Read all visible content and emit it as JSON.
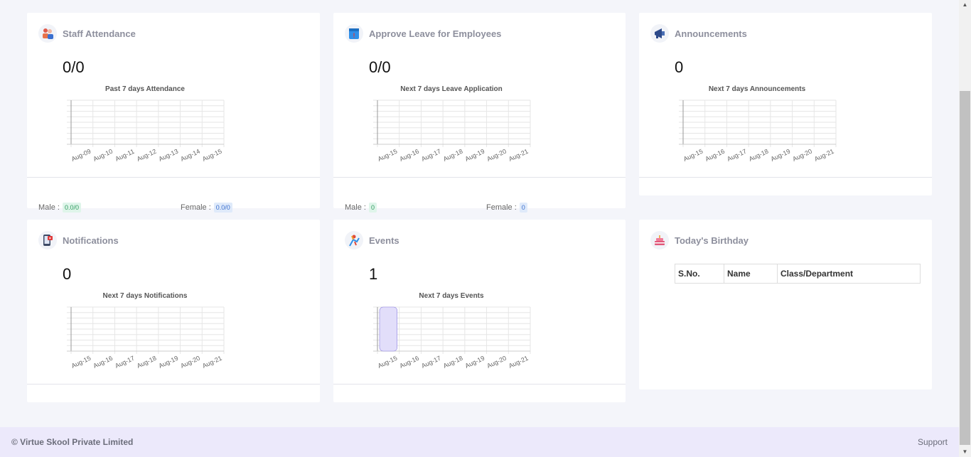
{
  "cards": {
    "staff": {
      "title": "Staff Attendance",
      "value": "0/0",
      "chart_title": "Past 7 days Attendance",
      "labels": [
        "Aug-09",
        "Aug-10",
        "Aug-11",
        "Aug-12",
        "Aug-13",
        "Aug-14",
        "Aug-15"
      ],
      "values": [
        0,
        0,
        0,
        0,
        0,
        0,
        0
      ],
      "male_label": "Male :",
      "male_value": "0.0/0",
      "female_label": "Female :",
      "female_value": "0.0/0"
    },
    "leave": {
      "title": "Approve Leave for Employees",
      "value": "0/0",
      "chart_title": "Next 7 days Leave Application",
      "labels": [
        "Aug-15",
        "Aug-16",
        "Aug-17",
        "Aug-18",
        "Aug-19",
        "Aug-20",
        "Aug-21"
      ],
      "values": [
        0,
        0,
        0,
        0,
        0,
        0,
        0
      ],
      "male_label": "Male :",
      "male_value": "0",
      "female_label": "Female :",
      "female_value": "0"
    },
    "announcements": {
      "title": "Announcements",
      "value": "0",
      "chart_title": "Next 7 days Announcements",
      "labels": [
        "Aug-15",
        "Aug-16",
        "Aug-17",
        "Aug-18",
        "Aug-19",
        "Aug-20",
        "Aug-21"
      ],
      "values": [
        0,
        0,
        0,
        0,
        0,
        0,
        0
      ]
    },
    "notifications": {
      "title": "Notifications",
      "value": "0",
      "chart_title": "Next 7 days Notifications",
      "labels": [
        "Aug-15",
        "Aug-16",
        "Aug-17",
        "Aug-18",
        "Aug-19",
        "Aug-20",
        "Aug-21"
      ],
      "values": [
        0,
        0,
        0,
        0,
        0,
        0,
        0
      ]
    },
    "events": {
      "title": "Events",
      "value": "1",
      "chart_title": "Next 7 days Events",
      "labels": [
        "Aug-15",
        "Aug-16",
        "Aug-17",
        "Aug-18",
        "Aug-19",
        "Aug-20",
        "Aug-21"
      ],
      "values": [
        1,
        0,
        0,
        0,
        0,
        0,
        0
      ]
    },
    "birthday": {
      "title": "Today's Birthday",
      "columns": [
        "S.No.",
        "Name",
        "Class/Department"
      ]
    }
  },
  "chart_data": [
    {
      "type": "bar",
      "title": "Past 7 days Attendance",
      "categories": [
        "Aug-09",
        "Aug-10",
        "Aug-11",
        "Aug-12",
        "Aug-13",
        "Aug-14",
        "Aug-15"
      ],
      "values": [
        0,
        0,
        0,
        0,
        0,
        0,
        0
      ]
    },
    {
      "type": "bar",
      "title": "Next 7 days Leave Application",
      "categories": [
        "Aug-15",
        "Aug-16",
        "Aug-17",
        "Aug-18",
        "Aug-19",
        "Aug-20",
        "Aug-21"
      ],
      "values": [
        0,
        0,
        0,
        0,
        0,
        0,
        0
      ]
    },
    {
      "type": "bar",
      "title": "Next 7 days Announcements",
      "categories": [
        "Aug-15",
        "Aug-16",
        "Aug-17",
        "Aug-18",
        "Aug-19",
        "Aug-20",
        "Aug-21"
      ],
      "values": [
        0,
        0,
        0,
        0,
        0,
        0,
        0
      ]
    },
    {
      "type": "bar",
      "title": "Next 7 days Notifications",
      "categories": [
        "Aug-15",
        "Aug-16",
        "Aug-17",
        "Aug-18",
        "Aug-19",
        "Aug-20",
        "Aug-21"
      ],
      "values": [
        0,
        0,
        0,
        0,
        0,
        0,
        0
      ]
    },
    {
      "type": "bar",
      "title": "Next 7 days Events",
      "categories": [
        "Aug-15",
        "Aug-16",
        "Aug-17",
        "Aug-18",
        "Aug-19",
        "Aug-20",
        "Aug-21"
      ],
      "values": [
        1,
        0,
        0,
        0,
        0,
        0,
        0
      ]
    }
  ],
  "footer": {
    "copyright": "© Virtue Skool Private Limited",
    "support": "Support"
  },
  "colors": {
    "background": "#f4f5fa",
    "footer_bg": "#ece9fb",
    "bar_fill": "#e2defa",
    "bar_stroke": "#8a7fe0"
  },
  "icons": {
    "staff": "staff-attendance-icon",
    "leave": "leave-calendar-icon",
    "announcements": "megaphone-icon",
    "notifications": "phone-notification-icon",
    "events": "event-icon",
    "birthday": "birthday-cake-icon"
  }
}
